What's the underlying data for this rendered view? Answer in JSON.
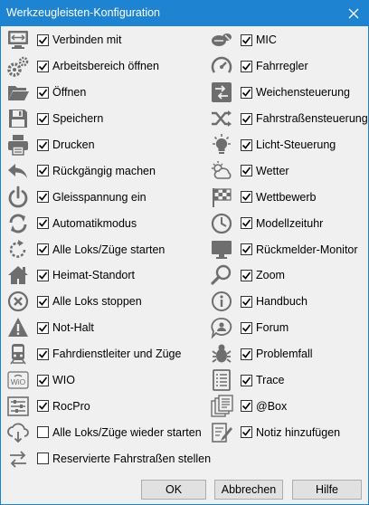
{
  "window": {
    "title": "Werkzeugleisten-Konfiguration"
  },
  "left_items": [
    {
      "label": "Verbinden mit",
      "icon": "connect-icon",
      "checked": true
    },
    {
      "label": "Arbeitsbereich öffnen",
      "icon": "gears-icon",
      "checked": true
    },
    {
      "label": "Öffnen",
      "icon": "folder-icon",
      "checked": true
    },
    {
      "label": "Speichern",
      "icon": "save-icon",
      "checked": true
    },
    {
      "label": "Drucken",
      "icon": "printer-icon",
      "checked": true
    },
    {
      "label": "Rückgängig machen",
      "icon": "undo-icon",
      "checked": true
    },
    {
      "label": "Gleisspannung ein",
      "icon": "power-icon",
      "checked": true
    },
    {
      "label": "Automatikmodus",
      "icon": "auto-cycle-icon",
      "checked": true
    },
    {
      "label": "Alle Loks/Züge starten",
      "icon": "start-all-icon",
      "checked": true
    },
    {
      "label": "Heimat-Standort",
      "icon": "home-icon",
      "checked": true
    },
    {
      "label": "Alle Loks stoppen",
      "icon": "stop-all-icon",
      "checked": true
    },
    {
      "label": "Not-Halt",
      "icon": "warning-icon",
      "checked": true
    },
    {
      "label": "Fahrdienstleiter und Züge",
      "icon": "train-icon",
      "checked": true
    },
    {
      "label": "WIO",
      "icon": "wio-icon",
      "checked": true
    },
    {
      "label": "RocPro",
      "icon": "sliders-icon",
      "checked": true
    },
    {
      "label": "Alle Loks/Züge wieder starten",
      "icon": "cloud-restart-icon",
      "checked": false
    },
    {
      "label": "Reservierte Fahrstraßen stellen",
      "icon": "swap-arrows-icon",
      "checked": false
    }
  ],
  "right_items": [
    {
      "label": "MIC",
      "icon": "mic-icon",
      "checked": true
    },
    {
      "label": "Fahrregler",
      "icon": "throttle-icon",
      "checked": true
    },
    {
      "label": "Weichensteuerung",
      "icon": "switch-control-icon",
      "checked": true
    },
    {
      "label": "Fahrstraßensteuerung",
      "icon": "route-shuffle-icon",
      "checked": true
    },
    {
      "label": "Licht-Steuerung",
      "icon": "light-bulb-icon",
      "checked": true
    },
    {
      "label": "Wetter",
      "icon": "weather-icon",
      "checked": true
    },
    {
      "label": "Wettbewerb",
      "icon": "checkered-flag-icon",
      "checked": true
    },
    {
      "label": "Modellzeituhr",
      "icon": "clock-icon",
      "checked": true
    },
    {
      "label": "Rückmelder-Monitor",
      "icon": "monitor-icon",
      "checked": true
    },
    {
      "label": "Zoom",
      "icon": "magnifier-icon",
      "checked": true
    },
    {
      "label": "Handbuch",
      "icon": "info-icon",
      "checked": true
    },
    {
      "label": "Forum",
      "icon": "forum-icon",
      "checked": true
    },
    {
      "label": "Problemfall",
      "icon": "bug-icon",
      "checked": true
    },
    {
      "label": "Trace",
      "icon": "trace-list-icon",
      "checked": true
    },
    {
      "label": "@Box",
      "icon": "box-copy-icon",
      "checked": true
    },
    {
      "label": "Notiz hinzufügen",
      "icon": "note-edit-icon",
      "checked": true
    }
  ],
  "buttons": {
    "ok": "OK",
    "cancel": "Abbrechen",
    "help": "Hilfe"
  },
  "colors": {
    "titlebar": "#1e84d2",
    "icon": "#6e6e6e",
    "background": "#f0f0f0"
  }
}
